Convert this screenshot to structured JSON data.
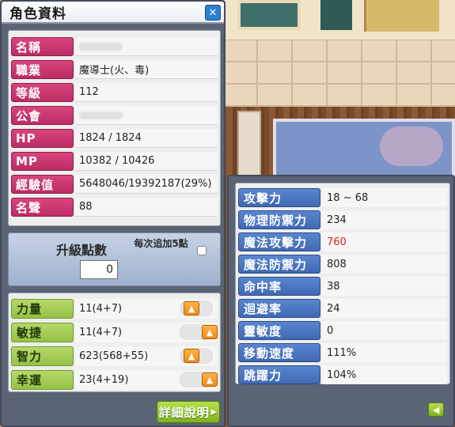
{
  "window": {
    "title": "角色資料",
    "close_icon": "close-icon"
  },
  "info": [
    {
      "label": "名稱",
      "value": ""
    },
    {
      "label": "職業",
      "value": "魔導士(火、毒)"
    },
    {
      "label": "等級",
      "value": "112"
    },
    {
      "label": "公會",
      "value": ""
    },
    {
      "label": "HP",
      "value": "1824 / 1824"
    },
    {
      "label": "MP",
      "value": "10382 / 10426"
    },
    {
      "label": "經驗值",
      "value": "5648046/19392187(29%)"
    },
    {
      "label": "名聲",
      "value": "88"
    }
  ],
  "ap": {
    "label": "升級點數",
    "value": "0",
    "auto_label": "每次追加5點",
    "auto_checked": false
  },
  "stats": [
    {
      "label": "力量",
      "value": "11(4+7)"
    },
    {
      "label": "敏捷",
      "value": "11(4+7)"
    },
    {
      "label": "智力",
      "value": "623(568+55)"
    },
    {
      "label": "幸運",
      "value": "23(4+19)"
    }
  ],
  "detail_button": {
    "label": "詳細說明",
    "icon": "arrow-right-icon"
  },
  "detail": [
    {
      "label": "攻擊力",
      "value": "18 ~ 68"
    },
    {
      "label": "物理防禦力",
      "value": "234"
    },
    {
      "label": "魔法攻擊力",
      "value": "760",
      "color": "#e02020"
    },
    {
      "label": "魔法防禦力",
      "value": "808"
    },
    {
      "label": "命中率",
      "value": "38"
    },
    {
      "label": "迴避率",
      "value": "24"
    },
    {
      "label": "靈敏度",
      "value": "0"
    },
    {
      "label": "移動速度",
      "value": "111%"
    },
    {
      "label": "跳躍力",
      "value": "104%"
    }
  ],
  "colors": {
    "info_label": "#c93570",
    "stat_label": "#a6cf58",
    "detail_label": "#4b77c1",
    "up_button": "#f59a22",
    "highlight_value": "#e02020"
  }
}
